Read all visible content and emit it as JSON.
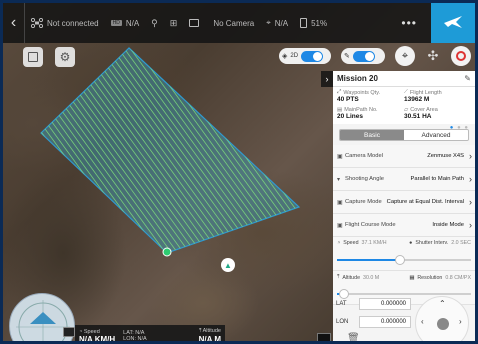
{
  "topbar": {
    "connection_status": "Not connected",
    "signal_value": "N/A",
    "camera_status": "No Camera",
    "gps_value": "N/A",
    "battery_value": "51%",
    "more_label": "•••"
  },
  "map_toggles": {
    "view_mode_label": "2D"
  },
  "mission": {
    "title": "Mission 20",
    "stats": {
      "waypoints_label": "Waypoints Qty.",
      "waypoints_value": "40 PTS",
      "flight_length_label": "Flight Length",
      "flight_length_value": "13962 M",
      "mainpath_label": "MainPath No.",
      "mainpath_value": "20 Lines",
      "cover_area_label": "Cover Area",
      "cover_area_value": "30.51 HA"
    },
    "tabs": {
      "basic": "Basic",
      "advanced": "Advanced",
      "active": "basic"
    },
    "settings": [
      {
        "label": "Camera Model",
        "value": "Zenmuse X4S"
      },
      {
        "label": "Shooting Angle",
        "value": "Parallel to Main Path"
      },
      {
        "label": "Capture Mode",
        "value": "Capture at Equal Dist. Interval"
      },
      {
        "label": "Flight Course Mode",
        "value": "Inside Mode"
      }
    ],
    "speed": {
      "label": "Speed",
      "value": "37.1 KM/H",
      "fraction": 0.47
    },
    "shutter": {
      "label": "Shutter Interv.",
      "value": "2.0 SEC"
    },
    "altitude": {
      "label": "Altitude",
      "value": "30.0 M",
      "fraction": 0.05
    },
    "resolution": {
      "label": "Resolution",
      "value": "0.8 CM/PX"
    },
    "lat": {
      "label": "LAT",
      "value": "0.000000"
    },
    "lon": {
      "label": "LON",
      "value": "0.000000"
    }
  },
  "telemetry": {
    "speed_label": "Speed",
    "speed_value": "N/A KM/H",
    "lat_label": "LAT: N/A",
    "lon_label": "LON: N/A",
    "altitude_label": "Altitude",
    "altitude_value": "N/A M"
  },
  "colors": {
    "accent": "#1e88e5",
    "brand": "#1e9bd7",
    "survey_fill": "#38a6c8",
    "survey_lines": "#7fe07a"
  }
}
